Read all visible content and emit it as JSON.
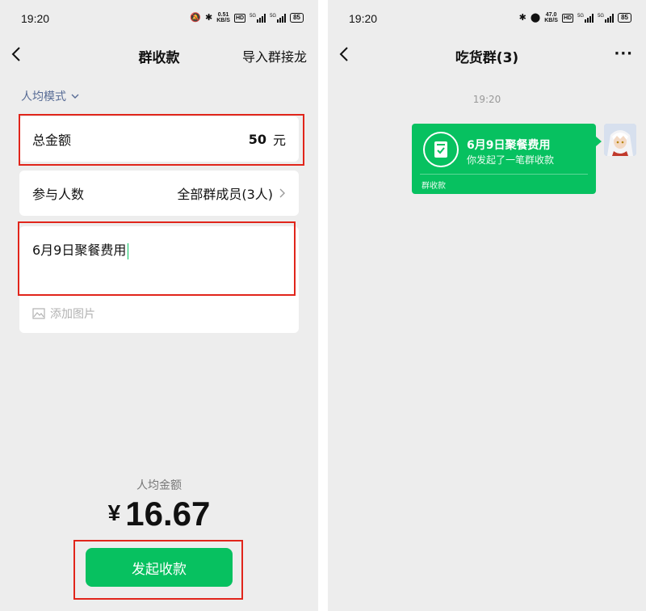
{
  "left": {
    "status": {
      "time": "19:20",
      "net_speed_value": "0.51",
      "net_speed_unit": "KB/S",
      "hd": "HD",
      "signal1_label": "5G",
      "signal2_label": "5G",
      "battery": "85"
    },
    "nav": {
      "title": "群收款",
      "right_action": "导入群接龙"
    },
    "mode_label": "人均模式",
    "total": {
      "label": "总金额",
      "value": "50",
      "unit": "元"
    },
    "participants": {
      "label": "参与人数",
      "value": "全部群成员(3人)"
    },
    "memo": {
      "text": "6月9日聚餐费用",
      "add_image": "添加图片"
    },
    "avg": {
      "label": "人均金额",
      "currency": "¥",
      "amount": "16.67"
    },
    "submit_button": "发起收款"
  },
  "right": {
    "status": {
      "time": "19:20",
      "net_speed_value": "47.0",
      "net_speed_unit": "KB/S",
      "hd": "HD",
      "signal1_label": "5G",
      "signal2_label": "5G",
      "battery": "85"
    },
    "nav": {
      "title": "吃货群(3)",
      "more": "···"
    },
    "chat_time": "19:20",
    "message": {
      "title": "6月9日聚餐费用",
      "subtitle": "你发起了一笔群收款",
      "footer": "群收款"
    }
  },
  "colors": {
    "accent": "#07c160",
    "link": "#576b95",
    "highlight_box": "#e1251b",
    "background": "#ededed"
  }
}
